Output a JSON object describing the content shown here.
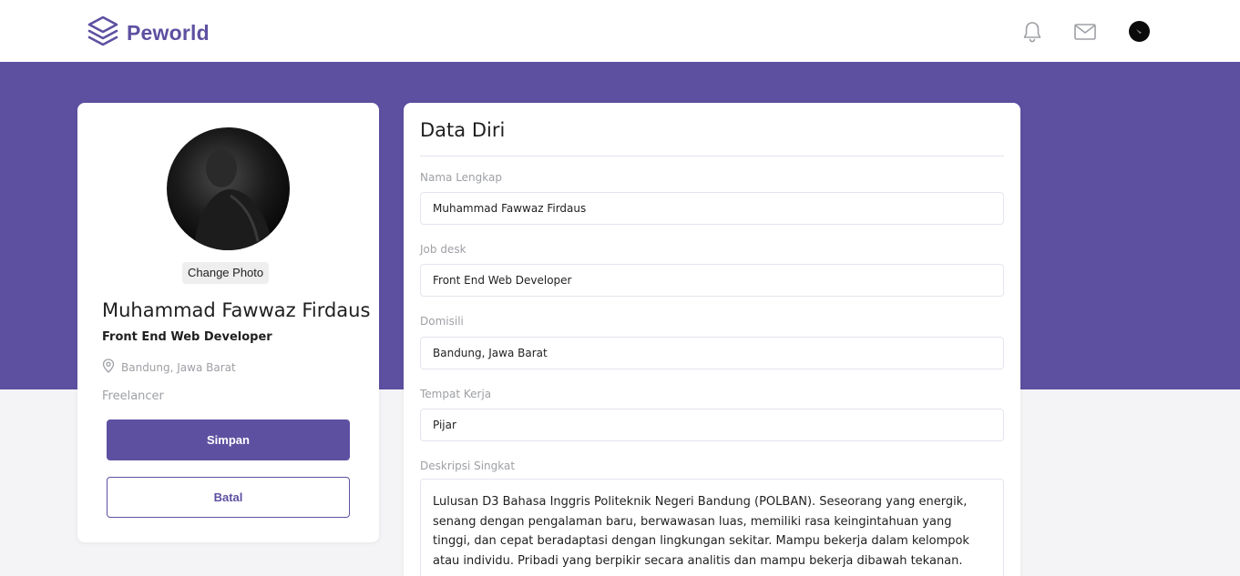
{
  "navbar": {
    "brand": "Peworld",
    "icons": [
      "layers-logo-icon",
      "bell-icon",
      "mail-icon",
      "avatar"
    ]
  },
  "profile": {
    "change_photo": "Change Photo",
    "name": "Muhammad Fawwaz Firdaus",
    "job": "Front End Web Developer",
    "location": "Bandung, Jawa Barat",
    "type": "Freelancer",
    "save_label": "Simpan",
    "cancel_label": "Batal"
  },
  "form": {
    "title": "Data Diri",
    "full_name": {
      "label": "Nama Lengkap",
      "value": "Muhammad Fawwaz Firdaus"
    },
    "job_desk": {
      "label": "Job desk",
      "value": "Front End Web Developer"
    },
    "domicile": {
      "label": "Domisili",
      "value": "Bandung, Jawa Barat"
    },
    "workplace": {
      "label": "Tempat Kerja",
      "value": "Pijar"
    },
    "description": {
      "label": "Deskripsi Singkat",
      "value": "Lulusan D3 Bahasa Inggris Politeknik Negeri Bandung (POLBAN). Seseorang yang energik, senang dengan pengalaman baru, berwawasan luas, memiliki rasa keingintahuan yang tinggi, dan cepat beradaptasi dengan lingkungan sekitar. Mampu bekerja dalam kelompok atau individu. Pribadi yang berpikir secara analitis dan mampu bekerja dibawah tekanan."
    }
  },
  "colors": {
    "primary": "#5e50a1",
    "background": "#f4f4f6",
    "muted_text": "#9ea0a5",
    "border": "#e2e5ed"
  }
}
